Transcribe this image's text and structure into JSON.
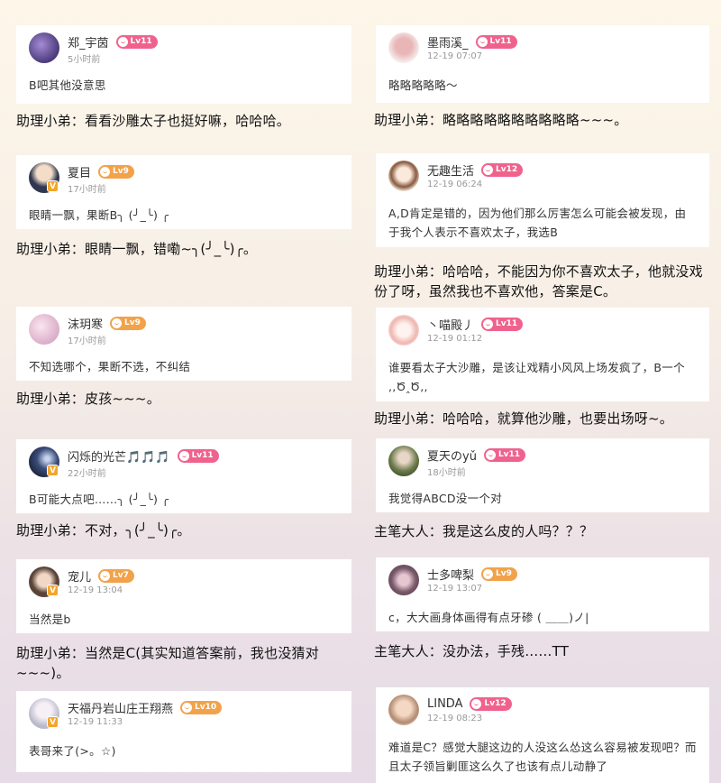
{
  "left": [
    {
      "card": {
        "name": "郑_宇茵",
        "level": "Lv11",
        "level_color": "pink",
        "time": "5小时前",
        "content": "B吧其他没意思",
        "avatar": "purple-flower-avatar",
        "avatar_color": "#5a4a8a",
        "vbadge": false
      },
      "reply": "助理小弟：看看沙雕太子也挺好嘛，哈哈哈。"
    },
    {
      "card": {
        "name": "夏目",
        "level": "Lv9",
        "level_color": "orange",
        "time": "17小时前",
        "content": "眼睛一飘，果断B╮ (╯_╰) ╭",
        "avatar": "anime-boy-avatar",
        "avatar_color": "#3a4660",
        "vbadge": true
      },
      "reply": "助理小弟：眼睛一飘，错嘞~╮(╯_╰)╭。"
    },
    {
      "card": {
        "name": "沫玥寒",
        "level": "Lv9",
        "level_color": "orange",
        "time": "17小时前",
        "content": "不知选哪个，果断不选，不纠结",
        "avatar": "pink-blossom-avatar",
        "avatar_color": "#e8c7d8",
        "vbadge": false
      },
      "reply": "助理小弟：皮孩~~~。"
    },
    {
      "card": {
        "name": "闪烁的光芒🎵🎵🎵",
        "level": "Lv11",
        "level_color": "pink",
        "time": "22小时前",
        "content": "B可能大点吧……╮ (╯_╰) ╭",
        "avatar": "galaxy-avatar",
        "avatar_color": "#2e3c5e",
        "vbadge": true
      },
      "reply": "助理小弟：不对，╮(╯_╰)╭。"
    },
    {
      "card": {
        "name": "宠儿",
        "level": "Lv7",
        "level_color": "orange",
        "time": "12-19 13:04",
        "content": "当然是b",
        "avatar": "girl-avatar",
        "avatar_color": "#6b5a4e",
        "vbadge": true
      },
      "reply": "助理小弟：当然是C(其实知道答案前，我也没猜对~~~)。"
    },
    {
      "card": {
        "name": "天福丹岩山庄王翔燕",
        "level": "Lv10",
        "level_color": "orange",
        "time": "12-19 11:33",
        "content": "表哥来了(>。☆)",
        "avatar": "anime-girl-avatar",
        "avatar_color": "#c9c9d6",
        "vbadge": true
      },
      "reply": ""
    }
  ],
  "right": [
    {
      "card": {
        "name": "墨雨溪_",
        "level": "Lv11",
        "level_color": "pink",
        "time": "12-19 07:07",
        "content": "略略略略略～",
        "avatar": "pink-flower-avatar",
        "avatar_color": "#d9a8a8",
        "vbadge": false
      },
      "reply": "助理小弟：略略略略略略略略略略~~~。"
    },
    {
      "card": {
        "name": "无趣生活",
        "level": "Lv12",
        "level_color": "pink",
        "time": "12-19 06:24",
        "content": "A,D肯定是错的，因为他们那么厉害怎么可能会被发现，由于我个人表示不喜欢太子，我选B",
        "avatar": "chibi-avatar",
        "avatar_color": "#e6d2c0",
        "vbadge": false
      },
      "reply": "助理小弟：哈哈哈，不能因为你不喜欢太子，他就没戏份了呀，虽然我也不喜欢他，答案是C。"
    },
    {
      "card": {
        "name": "丶喵殿丿",
        "level": "Lv11",
        "level_color": "pink",
        "time": "12-19 01:12",
        "content": "谁要看太子大沙雕，是该让戏精小风风上场发疯了，B一个 ,,Ծ‸Ծ,,",
        "avatar": "cat-girl-avatar",
        "avatar_color": "#f0d6d0",
        "vbadge": false
      },
      "reply": "助理小弟：哈哈哈，就算他沙雕，也要出场呀~。"
    },
    {
      "card": {
        "name": "夏天のyǔ",
        "level": "Lv11",
        "level_color": "pink",
        "time": "18小时前",
        "content": "我觉得ABCD没一个对",
        "avatar": "outdoor-avatar",
        "avatar_color": "#7a8a5a",
        "vbadge": false
      },
      "reply": "主笔大人：我是这么皮的人吗？？？"
    },
    {
      "card": {
        "name": "士多啤梨",
        "level": "Lv9",
        "level_color": "orange",
        "time": "12-19 13:07",
        "content": "c，大大画身体画得有点牙碜 ( ＿＿)ノ|",
        "avatar": "mouse-avatar",
        "avatar_color": "#8a6a7a",
        "vbadge": false
      },
      "reply": "主笔大人：没办法，手残……TT"
    },
    {
      "card": {
        "name": "LINDA",
        "level": "Lv12",
        "level_color": "pink",
        "time": "12-19 08:23",
        "content": "难道是C？感觉大腿这边的人没这么怂这么容易被发现吧？而且太子领旨剿匪这么久了也该有点儿动静了",
        "avatar": "baby-avatar",
        "avatar_color": "#c9a890",
        "vbadge": false
      },
      "reply": ""
    }
  ]
}
